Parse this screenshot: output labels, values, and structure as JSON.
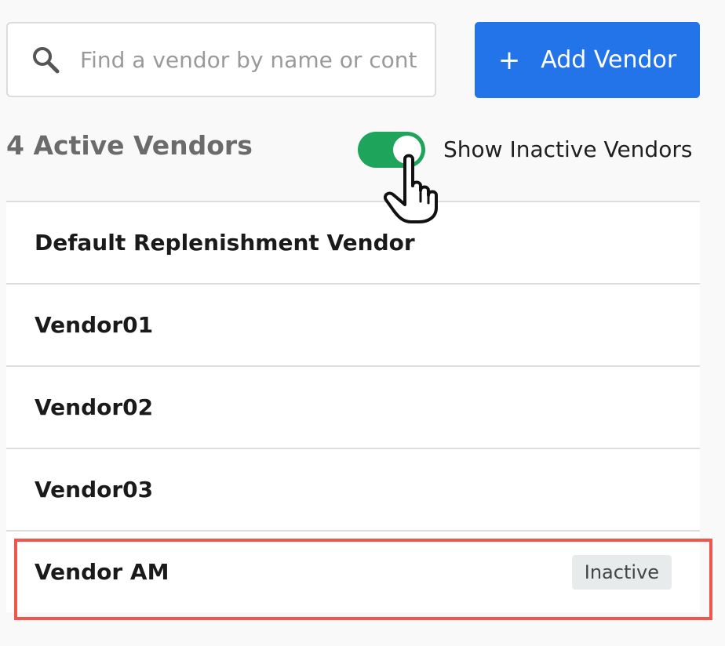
{
  "search": {
    "placeholder": "Find a vendor by name or cont"
  },
  "toolbar": {
    "add_icon": "+",
    "add_label": "Add Vendor"
  },
  "summary": {
    "active_count_label": "4 Active Vendors"
  },
  "filters": {
    "show_inactive_label": "Show Inactive Vendors",
    "show_inactive_on": true
  },
  "vendors": [
    {
      "name": "Default Replenishment Vendor"
    },
    {
      "name": "Vendor01"
    },
    {
      "name": "Vendor02"
    },
    {
      "name": "Vendor03"
    },
    {
      "name": "Vendor AM",
      "status": "Inactive"
    }
  ],
  "colors": {
    "primary": "#2374e8",
    "toggle_on": "#1fa45c",
    "highlight": "#f0564b",
    "badge_bg": "#e8ebec"
  },
  "icons": {
    "search": "search-icon",
    "add": "plus-icon",
    "cursor": "hand-pointer-icon"
  }
}
